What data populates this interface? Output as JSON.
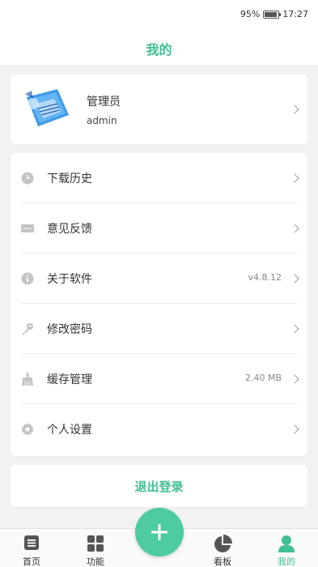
{
  "status": {
    "battery": "95%",
    "battery_level": 0.95,
    "time": "17:27"
  },
  "header": {
    "title": "我的"
  },
  "profile": {
    "name": "管理员",
    "username": "admin"
  },
  "menu": [
    {
      "label": "下载历史",
      "icon": "clock-icon",
      "value": ""
    },
    {
      "label": "意见反馈",
      "icon": "message-icon",
      "value": ""
    },
    {
      "label": "关于软件",
      "icon": "info-icon",
      "value": "v4.8.12"
    },
    {
      "label": "修改密码",
      "icon": "key-icon",
      "value": ""
    },
    {
      "label": "缓存管理",
      "icon": "broom-icon",
      "value": "2.40 MB"
    },
    {
      "label": "个人设置",
      "icon": "gear-icon",
      "value": ""
    }
  ],
  "logout": {
    "label": "退出登录"
  },
  "tabs": [
    {
      "label": "首页",
      "icon": "home-icon"
    },
    {
      "label": "功能",
      "icon": "grid-icon"
    },
    {
      "label": "看板",
      "icon": "pie-chart-icon"
    },
    {
      "label": "我的",
      "icon": "user-icon",
      "active": true
    }
  ],
  "colors": {
    "accent": "#3fbf95",
    "fab": "#4ecba0",
    "background": "#f2f2f2",
    "icon": "#c4c4c4"
  }
}
